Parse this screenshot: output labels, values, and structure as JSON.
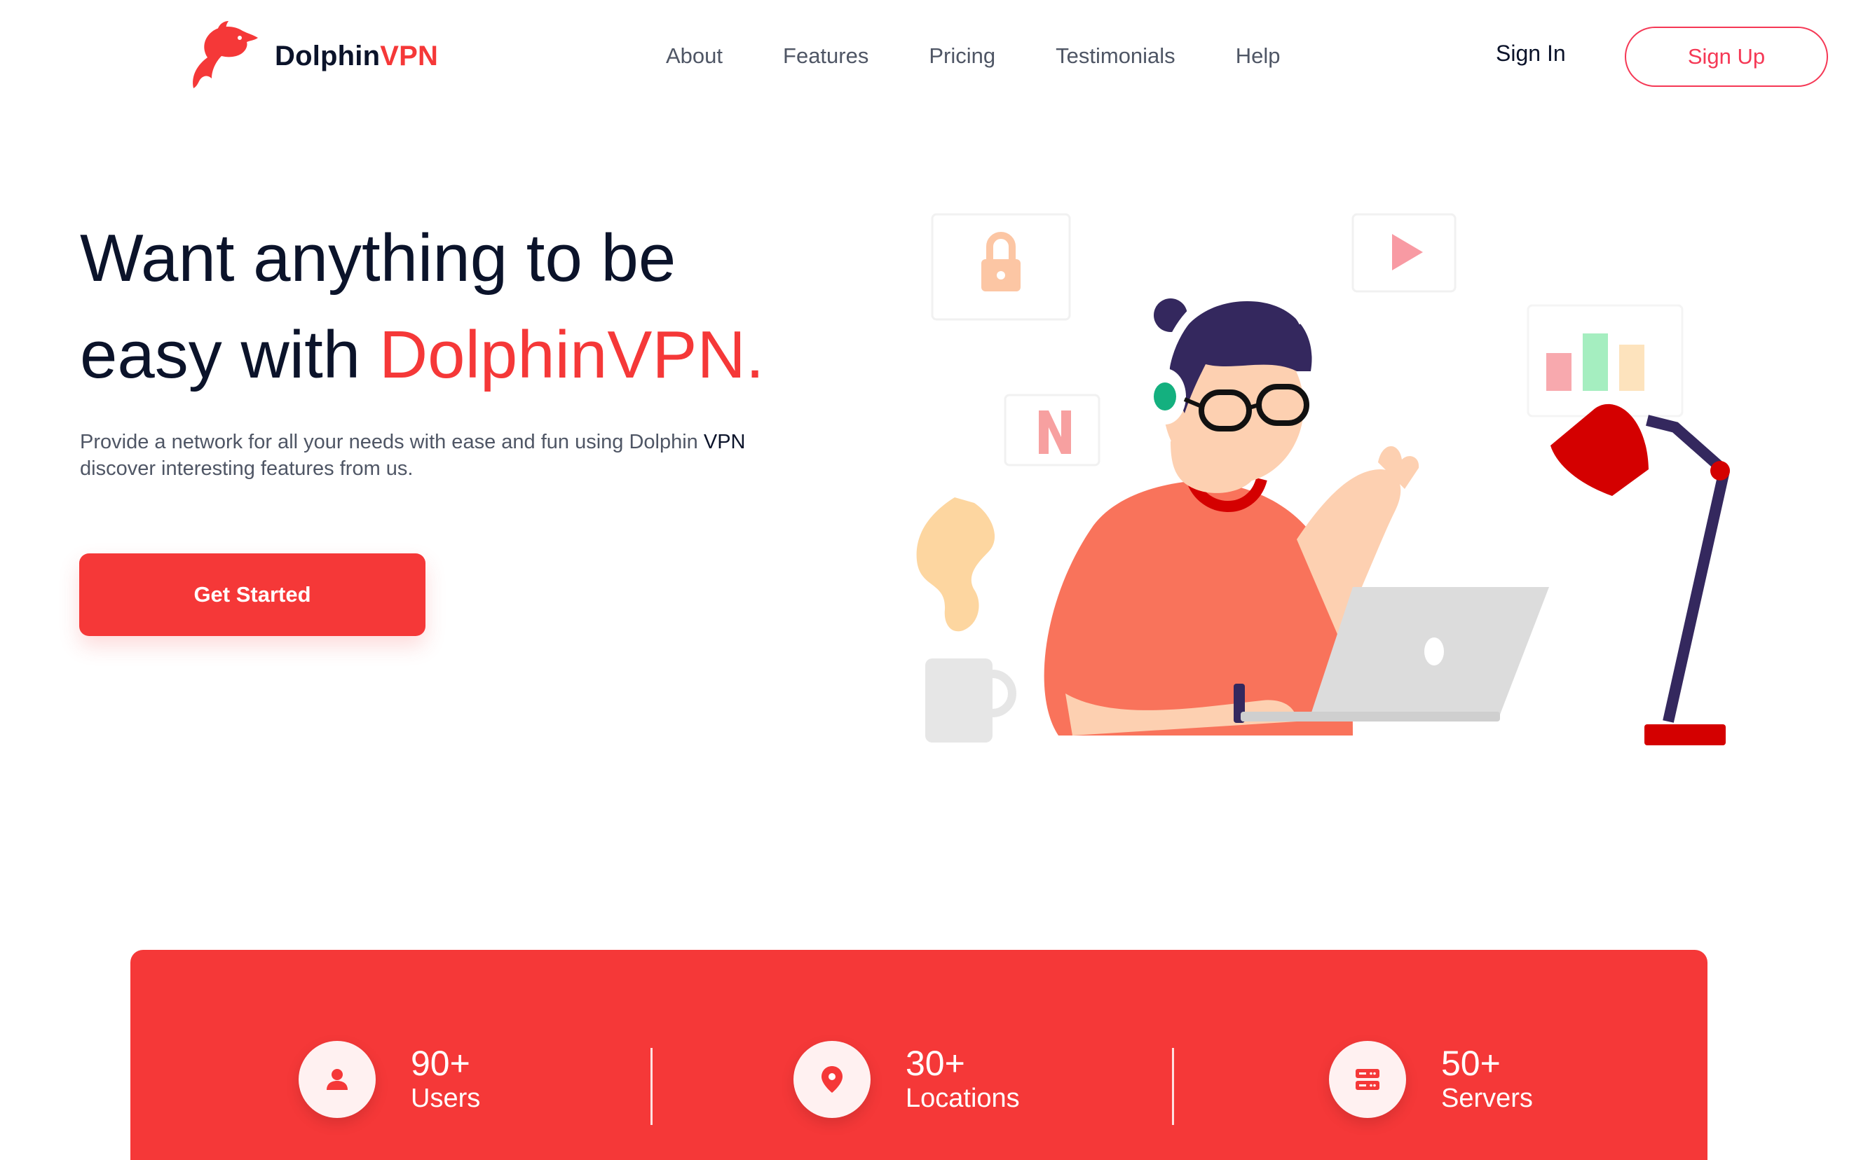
{
  "brand": {
    "name_main": "Dolphin",
    "name_accent": "VPN",
    "accent_color": "#f53838"
  },
  "nav": {
    "items": [
      "About",
      "Features",
      "Pricing",
      "Testimonials",
      "Help"
    ]
  },
  "auth": {
    "signin": "Sign In",
    "signup": "Sign Up"
  },
  "hero": {
    "title_line1": "Want anything to be",
    "title_line2_prefix": "easy with ",
    "title_line2_accent": "DolphinVPN.",
    "description_line1_prefix": "Provide a network for all your needs with ease and fun using Dolphin ",
    "description_line1_bold": "VPN",
    "description_line2": "discover interesting features from us.",
    "cta": "Get Started"
  },
  "illustration": {
    "icons": [
      "lock-icon",
      "play-icon",
      "netflix-icon",
      "bar-chart-icon"
    ]
  },
  "stats": [
    {
      "value": "90+",
      "label": "Users",
      "icon": "user-icon"
    },
    {
      "value": "30+",
      "label": "Locations",
      "icon": "location-pin-icon"
    },
    {
      "value": "50+",
      "label": "Servers",
      "icon": "server-icon"
    }
  ]
}
